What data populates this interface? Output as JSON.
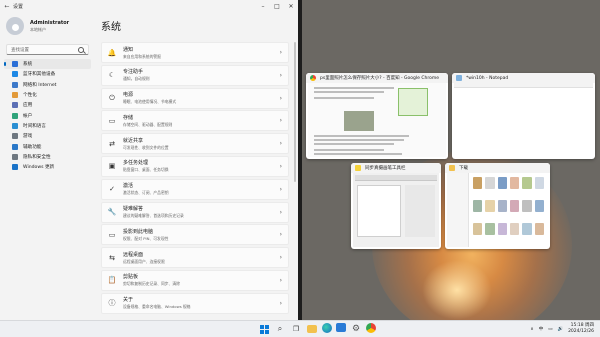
{
  "settings": {
    "window_title": "设置",
    "user": {
      "name": "Administrator",
      "account_type": "本地帐户"
    },
    "search_placeholder": "查找设置",
    "nav": [
      {
        "label": "系统",
        "icon": "system-icon",
        "color": "#2b6fd6",
        "active": true
      },
      {
        "label": "蓝牙和其他设备",
        "icon": "bluetooth-icon",
        "color": "#1e88e5"
      },
      {
        "label": "网络和 Internet",
        "icon": "wifi-icon",
        "color": "#3c79c9"
      },
      {
        "label": "个性化",
        "icon": "brush-icon",
        "color": "#e29a3a"
      },
      {
        "label": "应用",
        "icon": "apps-icon",
        "color": "#5b6fb5"
      },
      {
        "label": "帐户",
        "icon": "account-icon",
        "color": "#2fa37a"
      },
      {
        "label": "时间和语言",
        "icon": "globe-clock-icon",
        "color": "#2a8fd3"
      },
      {
        "label": "游戏",
        "icon": "gamepad-icon",
        "color": "#6e7780"
      },
      {
        "label": "辅助功能",
        "icon": "accessibility-icon",
        "color": "#2a78c8"
      },
      {
        "label": "隐私和安全性",
        "icon": "shield-icon",
        "color": "#6e7780"
      },
      {
        "label": "Windows 更新",
        "icon": "update-icon",
        "color": "#1a73c8"
      }
    ],
    "page_title": "系统",
    "cards": [
      {
        "title": "通知",
        "subtitle": "来自应用和系统的警报",
        "icon": "bell-icon",
        "glyph": "🔔"
      },
      {
        "title": "专注助手",
        "subtitle": "通知，自动规则",
        "icon": "moon-icon",
        "glyph": "☾"
      },
      {
        "title": "电源",
        "subtitle": "睡眠、电池使用情况、节电模式",
        "icon": "power-icon",
        "glyph": "⏻"
      },
      {
        "title": "存储",
        "subtitle": "存储空间、驱动器、配置规则",
        "icon": "storage-icon",
        "glyph": "▭"
      },
      {
        "title": "就近共享",
        "subtitle": "可发现性、收到文件的位置",
        "icon": "share-icon",
        "glyph": "⇄"
      },
      {
        "title": "多任务处理",
        "subtitle": "贴靠窗口、桌面、任务切换",
        "icon": "multitask-icon",
        "glyph": "▣"
      },
      {
        "title": "激活",
        "subtitle": "激活状态、订阅、产品密钥",
        "icon": "activation-icon",
        "glyph": "✓"
      },
      {
        "title": "疑难解答",
        "subtitle": "建议的疑难解答、首选项和历史记录",
        "icon": "wrench-icon",
        "glyph": "🔧"
      },
      {
        "title": "投影到此电脑",
        "subtitle": "权限、配对 PIN、可发现性",
        "icon": "project-icon",
        "glyph": "▭"
      },
      {
        "title": "远程桌面",
        "subtitle": "远程桌面用户、连接权限",
        "icon": "remote-icon",
        "glyph": "⇆"
      },
      {
        "title": "剪贴板",
        "subtitle": "剪切和复制历史记录、同步、清除",
        "icon": "clipboard-icon",
        "glyph": "📋"
      },
      {
        "title": "关于",
        "subtitle": "设备规格、重命名电脑、Windows 规格",
        "icon": "info-icon",
        "glyph": "ⓘ"
      }
    ]
  },
  "snap": {
    "windows": [
      {
        "title": "ps里面照片怎么保存照片大小? - 百度知 - Google Chrome",
        "icon": "chrome-icon"
      },
      {
        "title": "*win10h - Notepad",
        "icon": "notepad-icon"
      },
      {
        "title": "同步真摄画笔工具栏",
        "icon": "paint-icon"
      },
      {
        "title": "下载",
        "icon": "folder-icon"
      }
    ]
  },
  "taskbar": {
    "time": "15:18 周四",
    "date": "2024/12/26",
    "apps": [
      "windows-start-icon",
      "search-icon",
      "task-view-icon",
      "explorer-icon",
      "edge-icon",
      "store-icon",
      "settings-icon",
      "chrome-icon"
    ]
  }
}
